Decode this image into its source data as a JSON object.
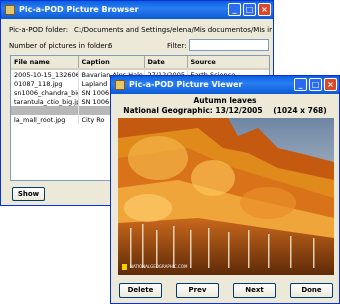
{
  "browser": {
    "title": "Pic-a-POD Picture Browser",
    "folder_label": "Pic-a-POD folder:",
    "folder_value": "C:/Documents and Settings/elena/Mis documentos/Mis imágenes",
    "count_label": "Number of pictures in folder:",
    "count_value": "6",
    "filter_label": "Filter:",
    "filter_value": "",
    "columns": [
      "File name",
      "Caption",
      "Date",
      "Source"
    ],
    "rows": [
      [
        "2005-10-15_132606",
        "Bavarian Alps Halo C",
        "27/12/2005",
        "Earth Science"
      ],
      [
        "01087_118.jpg",
        "Lapland",
        "",
        ""
      ],
      [
        "sn1006_chandra_big",
        "SN 1006",
        "",
        ""
      ],
      [
        "tarantula_ctio_big.jp",
        "SN 1006",
        "",
        ""
      ],
      [
        "",
        "",
        "",
        ""
      ],
      [
        "la_mall_root.jpg",
        "City Ro",
        "",
        ""
      ]
    ],
    "selected_row": 4,
    "show_button": "Show"
  },
  "viewer": {
    "title": "Pic-a-POD Picture Viewer",
    "caption": "Autumn leaves",
    "subtitle": "National Geographic: 13/12/2005",
    "dimensions": "(1024 x 768)",
    "watermark": "NATIONALGEOGRAPHIC.COM",
    "buttons": {
      "delete": "Delete",
      "prev": "Prev",
      "next": "Next",
      "done": "Done"
    }
  },
  "icons": {
    "app": "picture-icon",
    "minimize": "minimize-icon",
    "maximize": "maximize-icon",
    "close": "close-icon"
  },
  "colors": {
    "titlebar": "#0a5fe0",
    "window_bg": "#ece9d8",
    "close_button": "#d9482a"
  }
}
